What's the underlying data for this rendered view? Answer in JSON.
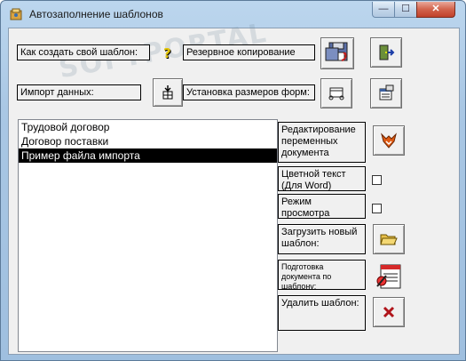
{
  "window": {
    "title": "Автозаполнение шаблонов",
    "watermark": "SOFTPORTAL",
    "controls": {
      "minimize": "—",
      "maximize": "☐",
      "close": "✕"
    }
  },
  "top_actions": {
    "how_to_create_label": "Как создать свой шаблон:",
    "backup_label": "Резервное копирование БД:",
    "import_label": "Импорт данных:",
    "form_size_label": "Установка размеров форм:"
  },
  "templates": {
    "items": [
      "Трудовой договор",
      "Договор поставки",
      "Пример файла импорта"
    ],
    "selected_index": 2
  },
  "side_actions": {
    "edit_variables_label": "Редактирование переменных документа",
    "color_text_label": "Цветной текст (Для Word)",
    "view_mode_label": "Режим просмотра шаблона",
    "load_template_label": "Загрузить новый шаблон:",
    "prepare_doc_label": "Подготовка документа по шаблону:",
    "delete_template_label": "Удалить шаблон:",
    "color_text_checked": false,
    "view_mode_checked": false
  },
  "icons": {
    "help": "question-mark-icon",
    "backup": "floppy-backup-icon",
    "exit": "exit-door-icon",
    "import": "import-arrow-icon",
    "form_size": "form-resize-icon",
    "settings": "settings-form-icon",
    "edit": "fox-edit-icon",
    "load": "open-folder-icon",
    "prepare": "document-prepare-icon",
    "delete": "delete-x-icon"
  }
}
